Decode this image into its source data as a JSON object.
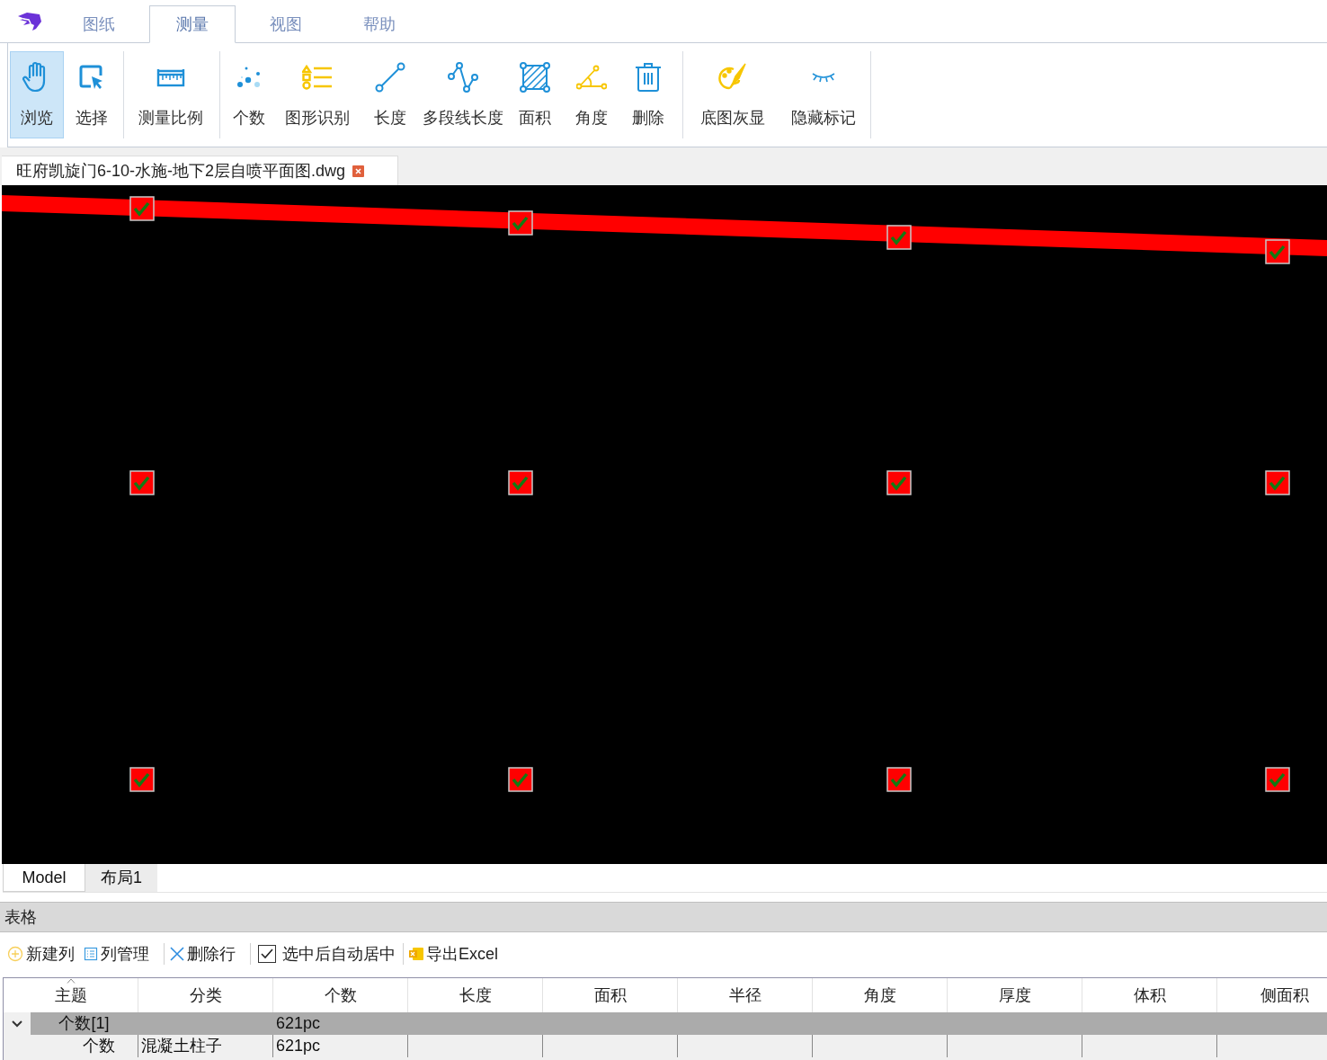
{
  "menu_tabs": [
    {
      "label": "图纸",
      "selected": false
    },
    {
      "label": "测量",
      "selected": true
    },
    {
      "label": "视图",
      "selected": false
    },
    {
      "label": "帮助",
      "selected": false
    }
  ],
  "ribbon_groups": [
    {
      "items": [
        {
          "kind": "hand",
          "label": "浏览",
          "selected": true
        },
        {
          "kind": "select",
          "label": "选择",
          "selected": false
        }
      ]
    },
    {
      "items": [
        {
          "kind": "ruler",
          "label": "测量比例",
          "selected": false
        }
      ]
    },
    {
      "items": [
        {
          "kind": "count",
          "label": "个数",
          "selected": false
        },
        {
          "kind": "shapes",
          "label": "图形识别",
          "selected": false
        },
        {
          "kind": "length",
          "label": "长度",
          "selected": false
        },
        {
          "kind": "polyline",
          "label": "多段线长度",
          "selected": false
        },
        {
          "kind": "area",
          "label": "面积",
          "selected": false
        },
        {
          "kind": "angle",
          "label": "角度",
          "selected": false
        },
        {
          "kind": "trash",
          "label": "删除",
          "selected": false
        }
      ]
    },
    {
      "items": [
        {
          "kind": "palette",
          "label": "底图灰显",
          "selected": false
        },
        {
          "kind": "eye",
          "label": "隐藏标记",
          "selected": false
        }
      ]
    }
  ],
  "document_tab": {
    "title": "旺府凯旋门6-10-水施-地下2层自喷平面图.dwg"
  },
  "layout_tabs": [
    {
      "label": "Model",
      "selected": true
    },
    {
      "label": "布局1",
      "selected": false
    }
  ],
  "table_panel": {
    "title": "表格",
    "toolbar_groups": [
      [
        {
          "kind": "add",
          "label": "新建列"
        },
        {
          "kind": "columns",
          "label": "列管理"
        }
      ],
      [
        {
          "kind": "delete",
          "label": "删除行"
        }
      ],
      [
        {
          "kind": "checkbox",
          "label": "选中后自动居中",
          "checked": true
        }
      ],
      [
        {
          "kind": "export",
          "label": "导出Excel"
        }
      ]
    ],
    "columns": [
      {
        "label": "主题",
        "sorted": true
      },
      {
        "label": "分类",
        "sorted": false
      },
      {
        "label": "个数",
        "sorted": false
      },
      {
        "label": "长度",
        "sorted": false
      },
      {
        "label": "面积",
        "sorted": false
      },
      {
        "label": "半径",
        "sorted": false
      },
      {
        "label": "角度",
        "sorted": false
      },
      {
        "label": "厚度",
        "sorted": false
      },
      {
        "label": "体积",
        "sorted": false
      },
      {
        "label": "侧面积",
        "sorted": false
      }
    ],
    "rows": [
      {
        "cells": [
          "个数[1]",
          "",
          "621pc"
        ],
        "expanded": true,
        "children": [
          {
            "cells": [
              "个数",
              "混凝土柱子",
              "621pc"
            ]
          }
        ]
      }
    ]
  }
}
